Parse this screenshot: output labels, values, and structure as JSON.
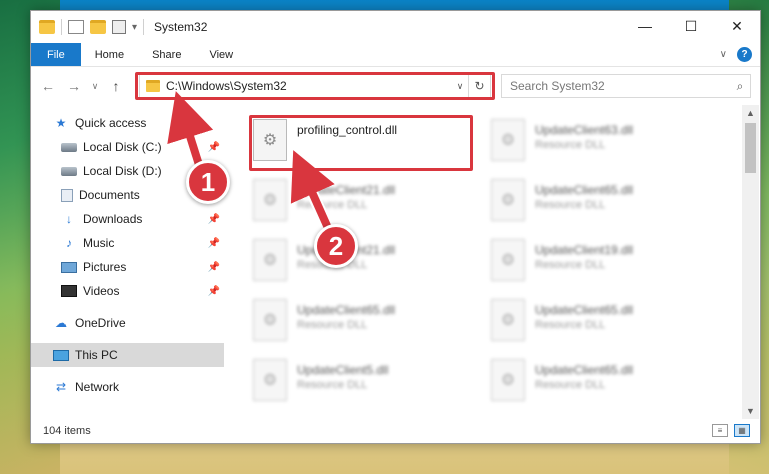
{
  "window": {
    "title": "System32",
    "controls": {
      "minimize": "—",
      "maximize": "☐",
      "close": "✕"
    }
  },
  "ribbon": {
    "tabs": [
      "File",
      "Home",
      "Share",
      "View"
    ],
    "help": "?",
    "expand": "∨"
  },
  "nav": {
    "back": "←",
    "forward": "→",
    "recent": "∨",
    "up": "↑",
    "address": "C:\\Windows\\System32",
    "address_dropdown": "∨",
    "refresh": "↻",
    "search_placeholder": "Search System32",
    "search_glyph": "⌕"
  },
  "sidebar": {
    "items": [
      {
        "label": "Quick access",
        "icon": "star-icon",
        "glyph": "★",
        "pinned": false
      },
      {
        "label": "Local Disk (C:)",
        "icon": "drive-icon",
        "glyph": "",
        "pinned": true
      },
      {
        "label": "Local Disk (D:)",
        "icon": "drive-icon",
        "glyph": "",
        "pinned": false
      },
      {
        "label": "Documents",
        "icon": "documents-icon",
        "glyph": "",
        "pinned": true
      },
      {
        "label": "Downloads",
        "icon": "downloads-icon",
        "glyph": "↓",
        "pinned": true
      },
      {
        "label": "Music",
        "icon": "music-icon",
        "glyph": "♪",
        "pinned": true
      },
      {
        "label": "Pictures",
        "icon": "pictures-icon",
        "glyph": "",
        "pinned": true
      },
      {
        "label": "Videos",
        "icon": "videos-icon",
        "glyph": "",
        "pinned": true
      },
      {
        "label": "OneDrive",
        "icon": "onedrive-icon",
        "glyph": "☁",
        "pinned": false
      },
      {
        "label": "This PC",
        "icon": "this-pc-icon",
        "glyph": "",
        "pinned": false
      },
      {
        "label": "Network",
        "icon": "network-icon",
        "glyph": "⇄",
        "pinned": false
      }
    ],
    "pin_glyph": "📌"
  },
  "files": [
    {
      "name": "profiling_control.dll",
      "type": "",
      "highlighted": true
    },
    {
      "name": "UpdateClient63.dll",
      "type": "Resource DLL"
    },
    {
      "name": "UpdateClient21.dll",
      "type": "Resource DLL"
    },
    {
      "name": "UpdateClient65.dll",
      "type": "Resource DLL"
    },
    {
      "name": "UpdateClient21.dll",
      "type": "Resource DLL"
    },
    {
      "name": "UpdateClient19.dll",
      "type": "Resource DLL"
    },
    {
      "name": "UpdateClient65.dll",
      "type": "Resource DLL"
    },
    {
      "name": "UpdateClient65.dll",
      "type": "Resource DLL"
    },
    {
      "name": "UpdateClient5.dll",
      "type": "Resource DLL"
    },
    {
      "name": "UpdateClient65.dll",
      "type": "Resource DLL"
    }
  ],
  "file_icon_glyph": "⚙",
  "status": {
    "count": "104 items"
  },
  "scroll": {
    "up": "▲",
    "down": "▼"
  },
  "view_toggles": {
    "details": "≡",
    "tiles": "▦"
  },
  "annotations": {
    "badge1": "1",
    "badge2": "2"
  },
  "colors": {
    "accent": "#1979ca",
    "highlight": "#d9363e"
  }
}
